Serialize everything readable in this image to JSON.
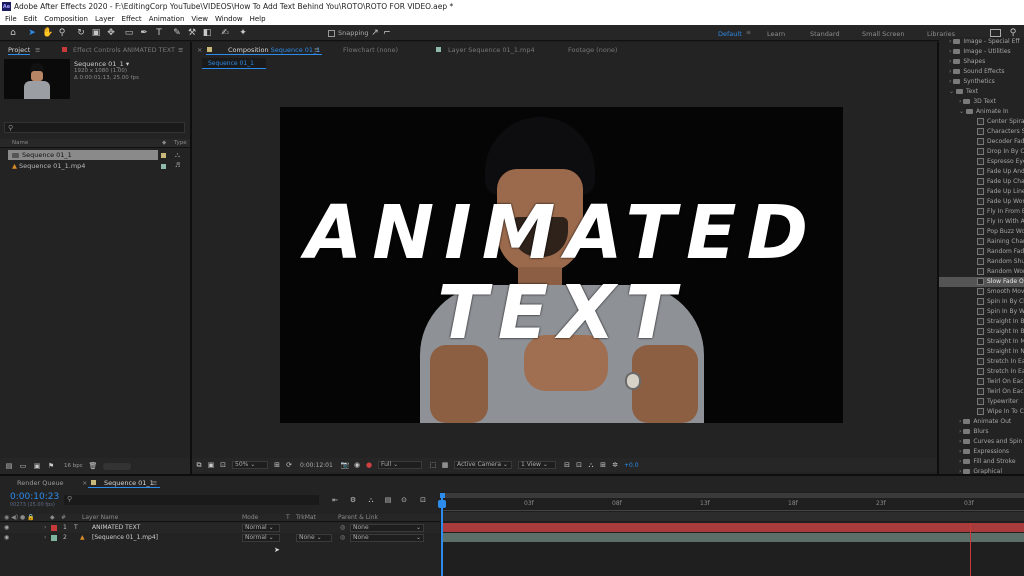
{
  "window": {
    "title": "Adobe After Effects 2020 - F:\\EditingCorp YouTube\\VIDEOS\\How To Add Text Behind You\\ROTO\\ROTO FOR VIDEO.aep *",
    "app_icon": "Ae"
  },
  "menu": [
    "File",
    "Edit",
    "Composition",
    "Layer",
    "Effect",
    "Animation",
    "View",
    "Window",
    "Help"
  ],
  "toolbar": {
    "snapping_label": "Snapping"
  },
  "workspaces": [
    "Default",
    "Learn",
    "Standard",
    "Small Screen",
    "Libraries"
  ],
  "project_panel": {
    "tab_project": "Project",
    "tab_effect_controls": "Effect Controls ANIMATED TEXT",
    "item_name": "Sequence 01_1 ▾",
    "item_resolution": "1920 x 1080 (1.00)",
    "item_duration": "Δ 0:00:01:13, 25.00 fps",
    "search_placeholder": "",
    "col_name": "Name",
    "col_type": "Type",
    "items": [
      {
        "name": "Sequence 01_1",
        "color": "#c8b87a",
        "selected": true
      },
      {
        "name": "Sequence 01_1.mp4",
        "color": "#8fb9a8",
        "selected": false
      }
    ],
    "bpc": "16 bpc"
  },
  "composition_tabs": {
    "comp_label": "Composition",
    "comp_name": "Sequence 01_1",
    "flowchart": "Flowchart (none)",
    "layer": "Layer Sequence 01_1.mp4",
    "footage": "Footage (none)",
    "sub_tab": "Sequence 01_1"
  },
  "viewer": {
    "line1": "ANIMATED",
    "line2": "TEXT"
  },
  "viewer_controls": {
    "zoom": "50%",
    "timecode": "0:00:12:01",
    "resolution": "Full",
    "camera": "Active Camera",
    "view": "1 View",
    "exposure": "+0.0"
  },
  "effects_panel": {
    "items": [
      {
        "label": "Image - Special Eff",
        "level": 1,
        "type": "folder"
      },
      {
        "label": "Image - Utilities",
        "level": 1,
        "type": "folder"
      },
      {
        "label": "Shapes",
        "level": 1,
        "type": "folder"
      },
      {
        "label": "Sound Effects",
        "level": 1,
        "type": "folder"
      },
      {
        "label": "Synthetics",
        "level": 1,
        "type": "folder"
      },
      {
        "label": "Text",
        "level": 1,
        "type": "folder"
      },
      {
        "label": "3D Text",
        "level": 2,
        "type": "folder"
      },
      {
        "label": "Animate In",
        "level": 2,
        "type": "folder"
      },
      {
        "label": "Center Spiral",
        "level": 3,
        "type": "effect"
      },
      {
        "label": "Characters Sc",
        "level": 3,
        "type": "effect"
      },
      {
        "label": "Decoder Fade",
        "level": 3,
        "type": "effect"
      },
      {
        "label": "Drop In By Ch",
        "level": 3,
        "type": "effect"
      },
      {
        "label": "Espresso Eye",
        "level": 3,
        "type": "effect"
      },
      {
        "label": "Fade Up And",
        "level": 3,
        "type": "effect"
      },
      {
        "label": "Fade Up Cha",
        "level": 3,
        "type": "effect"
      },
      {
        "label": "Fade Up Line",
        "level": 3,
        "type": "effect"
      },
      {
        "label": "Fade Up Wor",
        "level": 3,
        "type": "effect"
      },
      {
        "label": "Fly In From B",
        "level": 3,
        "type": "effect"
      },
      {
        "label": "Fly In With A",
        "level": 3,
        "type": "effect"
      },
      {
        "label": "Pop Buzz Wo",
        "level": 3,
        "type": "effect"
      },
      {
        "label": "Raining Chara",
        "level": 3,
        "type": "effect"
      },
      {
        "label": "Random Fade",
        "level": 3,
        "type": "effect"
      },
      {
        "label": "Random Shuf",
        "level": 3,
        "type": "effect"
      },
      {
        "label": "Random Wor",
        "level": 3,
        "type": "effect"
      },
      {
        "label": "Slow Fade O",
        "level": 3,
        "type": "effect",
        "selected": true
      },
      {
        "label": "Smooth Move",
        "level": 3,
        "type": "effect"
      },
      {
        "label": "Spin In By Ch",
        "level": 3,
        "type": "effect"
      },
      {
        "label": "Spin In By W",
        "level": 3,
        "type": "effect"
      },
      {
        "label": "Straight In B",
        "level": 3,
        "type": "effect"
      },
      {
        "label": "Straight In B",
        "level": 3,
        "type": "effect"
      },
      {
        "label": "Straight In M",
        "level": 3,
        "type": "effect"
      },
      {
        "label": "Straight In N",
        "level": 3,
        "type": "effect"
      },
      {
        "label": "Stretch In Ea",
        "level": 3,
        "type": "effect"
      },
      {
        "label": "Stretch In Ea",
        "level": 3,
        "type": "effect"
      },
      {
        "label": "Twirl On Eac",
        "level": 3,
        "type": "effect"
      },
      {
        "label": "Twirl On Eac",
        "level": 3,
        "type": "effect"
      },
      {
        "label": "Typewriter",
        "level": 3,
        "type": "effect"
      },
      {
        "label": "Wipe In To Ce",
        "level": 3,
        "type": "effect"
      },
      {
        "label": "Animate Out",
        "level": 2,
        "type": "folder"
      },
      {
        "label": "Blurs",
        "level": 2,
        "type": "folder"
      },
      {
        "label": "Curves and Spin",
        "level": 2,
        "type": "folder"
      },
      {
        "label": "Expressions",
        "level": 2,
        "type": "folder"
      },
      {
        "label": "Fill and Stroke",
        "level": 2,
        "type": "folder"
      },
      {
        "label": "Graphical",
        "level": 2,
        "type": "folder"
      }
    ]
  },
  "timeline": {
    "tab_render_queue": "Render Queue",
    "tab_sequence": "Sequence 01_1",
    "current_time": "0:00:10:23",
    "frame_info": "00273 (25.00 fps)",
    "search_placeholder": "",
    "col_layer_name": "Layer Name",
    "col_mode": "Mode",
    "col_t": "T",
    "col_trkmat": "TrkMat",
    "col_parent": "Parent & Link",
    "ruler_ticks": [
      "03f",
      "08f",
      "13f",
      "18f",
      "23f",
      "03f"
    ],
    "layers": [
      {
        "index": "1",
        "type_icon": "T",
        "name": "ANIMATED TEXT",
        "mode": "Normal",
        "trkmat": "",
        "parent": "None",
        "color": "#c83a3a"
      },
      {
        "index": "2",
        "type_icon": "▲",
        "name": "[Sequence 01_1.mp4]",
        "mode": "Normal",
        "trkmat": "None",
        "parent": "None",
        "color": "#7fb5a0"
      }
    ]
  },
  "colors": {
    "accent": "#2d8ceb",
    "layer1_bar": "#a83c3c",
    "layer2_bar": "#5b6e68"
  }
}
